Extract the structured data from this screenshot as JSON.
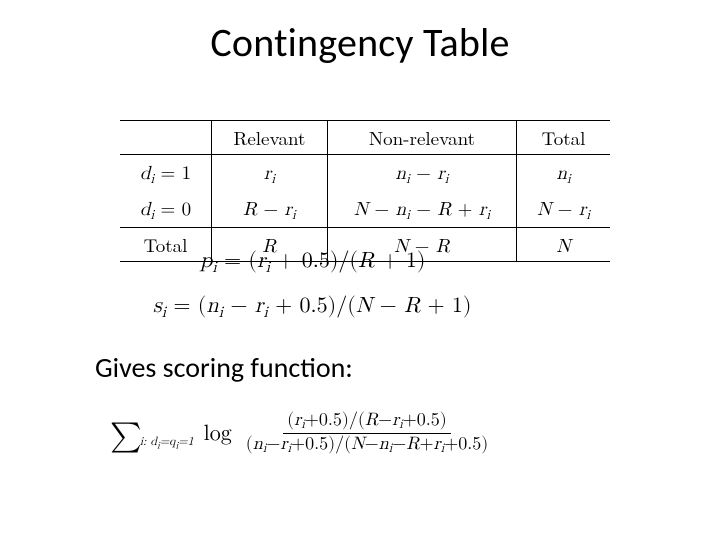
{
  "title": "Contingency Table",
  "table": {
    "headers": {
      "c1": "",
      "c2": "Relevant",
      "c3": "Non-relevant",
      "c4": "Total"
    },
    "row1": {
      "c1": "d_i = 1",
      "c2": "r_i",
      "c3": "n_i − r_i",
      "c4": "n_i"
    },
    "row2": {
      "c1": "d_i = 0",
      "c2": "R − r_i",
      "c3": "N − n_i − R + r_i",
      "c4": "N − r_i"
    },
    "total": {
      "c1": "Total",
      "c2": "R",
      "c3": "N − R",
      "c4": "N"
    }
  },
  "equations": {
    "p_i": "p_i = (r_i + 0.5)/(R + 1)",
    "s_i": "s_i = (n_i − r_i + 0.5)/(N − R + 1)"
  },
  "subtitle": "Gives scoring function:",
  "scoring": {
    "sum_index": "i: d_i = q_i = 1",
    "log": "log",
    "numerator": "(r_i + 0.5)/(R − r_i + 0.5)",
    "denominator": "(n_i − r_i + 0.5)/(N − n_i − R + r_i + 0.5)"
  }
}
